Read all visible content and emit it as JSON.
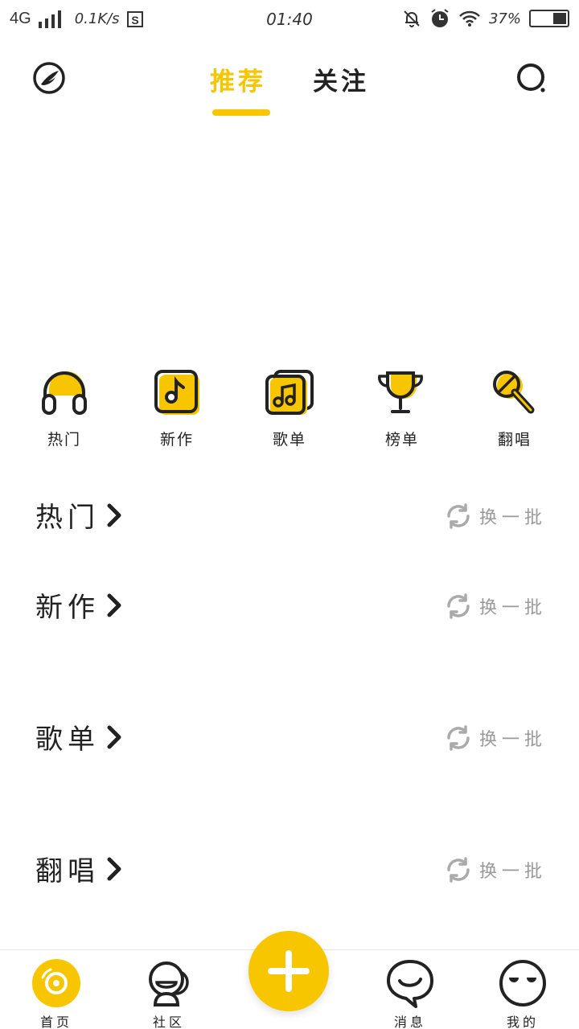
{
  "status_bar": {
    "network": "4G",
    "speed": "0.1K/s",
    "time": "01:40",
    "battery": "37%",
    "battery_level": 0.37
  },
  "header": {
    "tabs": [
      {
        "label": "推荐",
        "active": true
      },
      {
        "label": "关注",
        "active": false
      }
    ]
  },
  "categories": [
    {
      "label": "热门",
      "icon": "headphones-icon"
    },
    {
      "label": "新作",
      "icon": "music-note-icon"
    },
    {
      "label": "歌单",
      "icon": "playlist-icon"
    },
    {
      "label": "榜单",
      "icon": "trophy-icon"
    },
    {
      "label": "翻唱",
      "icon": "microphone-icon"
    }
  ],
  "sections": [
    {
      "title": "热门",
      "refresh_label": "换一批"
    },
    {
      "title": "新作",
      "refresh_label": "换一批"
    },
    {
      "title": "歌单",
      "refresh_label": "换一批"
    },
    {
      "title": "翻唱",
      "refresh_label": "换一批"
    }
  ],
  "bottom_nav": [
    {
      "label": "首页",
      "icon": "disc-icon"
    },
    {
      "label": "社区",
      "icon": "community-icon"
    },
    {
      "label": "消息",
      "icon": "message-icon"
    },
    {
      "label": "我的",
      "icon": "profile-icon"
    }
  ],
  "colors": {
    "accent": "#f7c600",
    "text": "#222222",
    "muted": "#999999"
  }
}
